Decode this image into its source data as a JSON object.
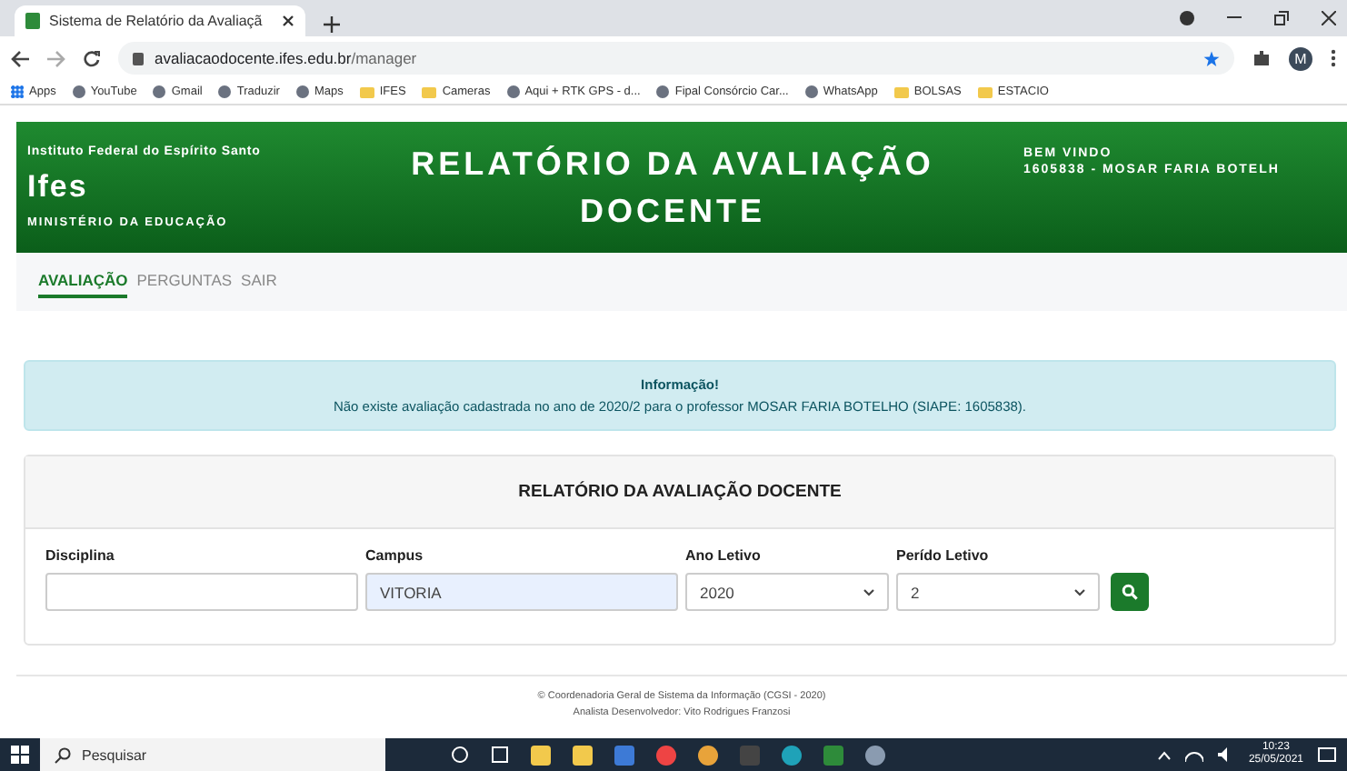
{
  "browser": {
    "tab_title": "Sistema de Relatório da Avaliaçã",
    "url_host": "avaliacaodocente.ifes.edu.br",
    "url_path": "/manager",
    "bookmarks": [
      {
        "label": "Apps",
        "kind": "apps"
      },
      {
        "label": "YouTube",
        "kind": "site"
      },
      {
        "label": "Gmail",
        "kind": "site"
      },
      {
        "label": "Traduzir",
        "kind": "site"
      },
      {
        "label": "Maps",
        "kind": "site"
      },
      {
        "label": "IFES",
        "kind": "folder"
      },
      {
        "label": "Cameras",
        "kind": "folder"
      },
      {
        "label": "Aqui + RTK GPS - d...",
        "kind": "site"
      },
      {
        "label": "Fipal Consórcio Car...",
        "kind": "site"
      },
      {
        "label": "WhatsApp",
        "kind": "site"
      },
      {
        "label": "BOLSAS",
        "kind": "folder"
      },
      {
        "label": "ESTACIO",
        "kind": "folder"
      }
    ],
    "profile_initial": "M"
  },
  "header": {
    "institute": "Instituto Federal do Espírito Santo",
    "logo": "Ifes",
    "ministry": "MINISTÉRIO DA EDUCAÇÃO",
    "title": "RELATÓRIO DA AVALIAÇÃO DOCENTE",
    "welcome": "BEM VINDO",
    "user": "1605838 - MOSAR FARIA BOTELH"
  },
  "nav": [
    {
      "label": "AVALIAÇÃO",
      "selected": true
    },
    {
      "label": "PERGUNTAS",
      "selected": false
    },
    {
      "label": "SAIR",
      "selected": false
    }
  ],
  "alert": {
    "title": "Informação!",
    "message": "Não existe avaliação cadastrada no ano de 2020/2 para o professor MOSAR FARIA BOTELHO (SIAPE: 1605838)."
  },
  "form": {
    "title": "RELATÓRIO DA AVALIAÇÃO DOCENTE",
    "fields": [
      {
        "label": "Disciplina",
        "kind": "input"
      },
      {
        "label": "Campus",
        "kind": "readonly",
        "value": "VITORIA"
      },
      {
        "label": "Ano Letivo",
        "kind": "select",
        "value": "2020"
      },
      {
        "label": "Perído Letivo",
        "kind": "select",
        "value": "2"
      }
    ]
  },
  "footer": [
    "© Coordenadoria Geral de Sistema da Informação (CGSI - 2020)",
    "Analista Desenvolvedor: Vito Rodrigues Franzosi"
  ],
  "taskbar": {
    "search_placeholder": "Pesquisar",
    "time": "10:23",
    "date": "25/05/2021"
  }
}
